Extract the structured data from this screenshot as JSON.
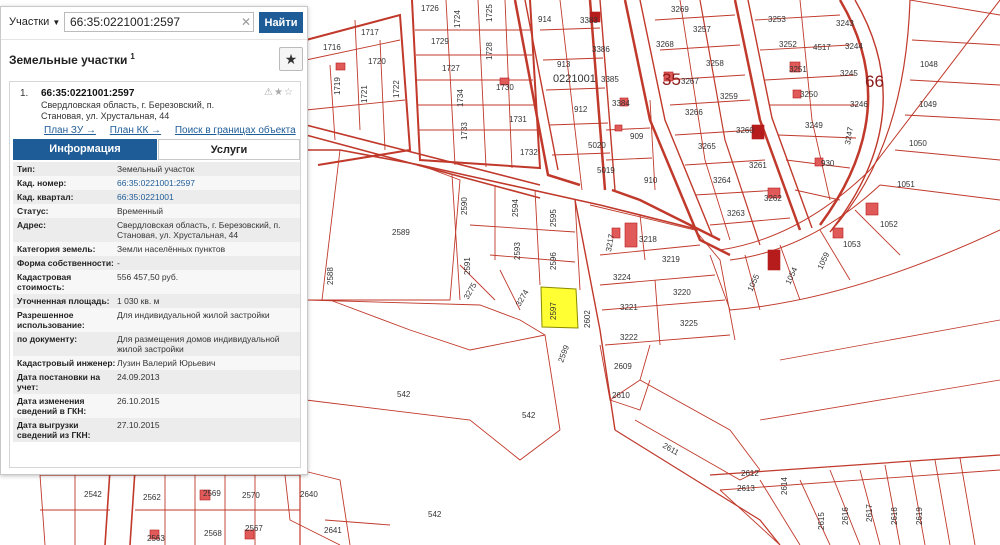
{
  "search": {
    "dropdown_label": "Участки",
    "query": "66:35:0221001:2597",
    "clear_glyph": "✕",
    "button_label": "Найти"
  },
  "results": {
    "section_title": "Земельные участки",
    "count_sup": "1",
    "favorite_icon": "★"
  },
  "card": {
    "index": "1.",
    "cadastral_number": "66:35:0221001:2597",
    "address": "Свердловская область, г. Березовский, п. Становая, ул. Хрустальная, 44",
    "links": {
      "plan_zu": "План ЗУ →",
      "plan_kk": "План КК →",
      "search_bounds": "Поиск в границах объекта →"
    },
    "tabs": {
      "info": "Информация",
      "services": "Услуги"
    },
    "rows": [
      {
        "key": "Тип:",
        "value": "Земельный участок"
      },
      {
        "key": "Кад. номер:",
        "value": "66:35:0221001:2597",
        "link": true
      },
      {
        "key": "Кад. квартал:",
        "value": "66:35:0221001",
        "link": true
      },
      {
        "key": "Статус:",
        "value": "Временный"
      },
      {
        "key": "Адрес:",
        "value": "Свердловская область, г. Березовский, п. Становая, ул. Хрустальная, 44"
      },
      {
        "key": "Категория земель:",
        "value": "Земли населённых пунктов"
      },
      {
        "key": "Форма собственности:",
        "value": "-"
      },
      {
        "key": "Кадастровая стоимость:",
        "value": "556 457,50 руб."
      },
      {
        "key": "Уточненная площадь:",
        "value": "1 030 кв. м"
      },
      {
        "key": "Разрешенное использование:",
        "value": "Для индивидуальной жилой застройки"
      },
      {
        "key": "по документу:",
        "value": "Для размещения домов индивидуальной жилой застройки"
      },
      {
        "key": "Кадастровый инженер:",
        "value": "Лузин Валерий Юрьевич"
      },
      {
        "key": "Дата постановки на учет:",
        "value": "24.09.2013"
      },
      {
        "key": "Дата изменения сведений в ГКН:",
        "value": "26.10.2015"
      },
      {
        "key": "Дата выгрузки сведений из ГКН:",
        "value": "27.10.2015"
      }
    ]
  },
  "map": {
    "colors": {
      "boundary": "#c0392b",
      "highlight": "#ffff33",
      "building": "#e05a5a",
      "building_dark": "#b71c1c"
    },
    "quarter_labels": [
      "35",
      "66",
      "0221001"
    ],
    "parcel_labels": [
      "1726",
      "1724",
      "1725",
      "1729",
      "1728",
      "1727",
      "1730",
      "1734",
      "1731",
      "1733",
      "1732",
      "1716",
      "1717",
      "1720",
      "1719",
      "1721",
      "1722",
      "914",
      "913",
      "912",
      "909",
      "5020",
      "5019",
      "910",
      "3383",
      "3386",
      "3385",
      "3384",
      "3269",
      "3257",
      "3268",
      "3258",
      "3267",
      "3259",
      "3266",
      "3260",
      "3265",
      "3261",
      "3264",
      "3263",
      "3262",
      "3253",
      "3243",
      "3252",
      "4517",
      "3244",
      "3251",
      "3245",
      "3250",
      "3246",
      "3249",
      "3247",
      "930",
      "1048",
      "1049",
      "1050",
      "1051",
      "1052",
      "1053",
      "1054",
      "1055",
      "1059",
      "2589",
      "2590",
      "2594",
      "2595",
      "2591",
      "2593",
      "2596",
      "2588",
      "3275",
      "3274",
      "2597",
      "2602",
      "2599",
      "3217",
      "3218",
      "3224",
      "3219",
      "3221",
      "3220",
      "3222",
      "3225",
      "2609",
      "2610",
      "2611",
      "542",
      "542",
      "542",
      "2612",
      "2613",
      "2614",
      "2615",
      "2616",
      "2617",
      "2618",
      "2619",
      "2542",
      "2562",
      "2569",
      "2570",
      "2568",
      "2567",
      "2563",
      "2640",
      "2641"
    ]
  }
}
